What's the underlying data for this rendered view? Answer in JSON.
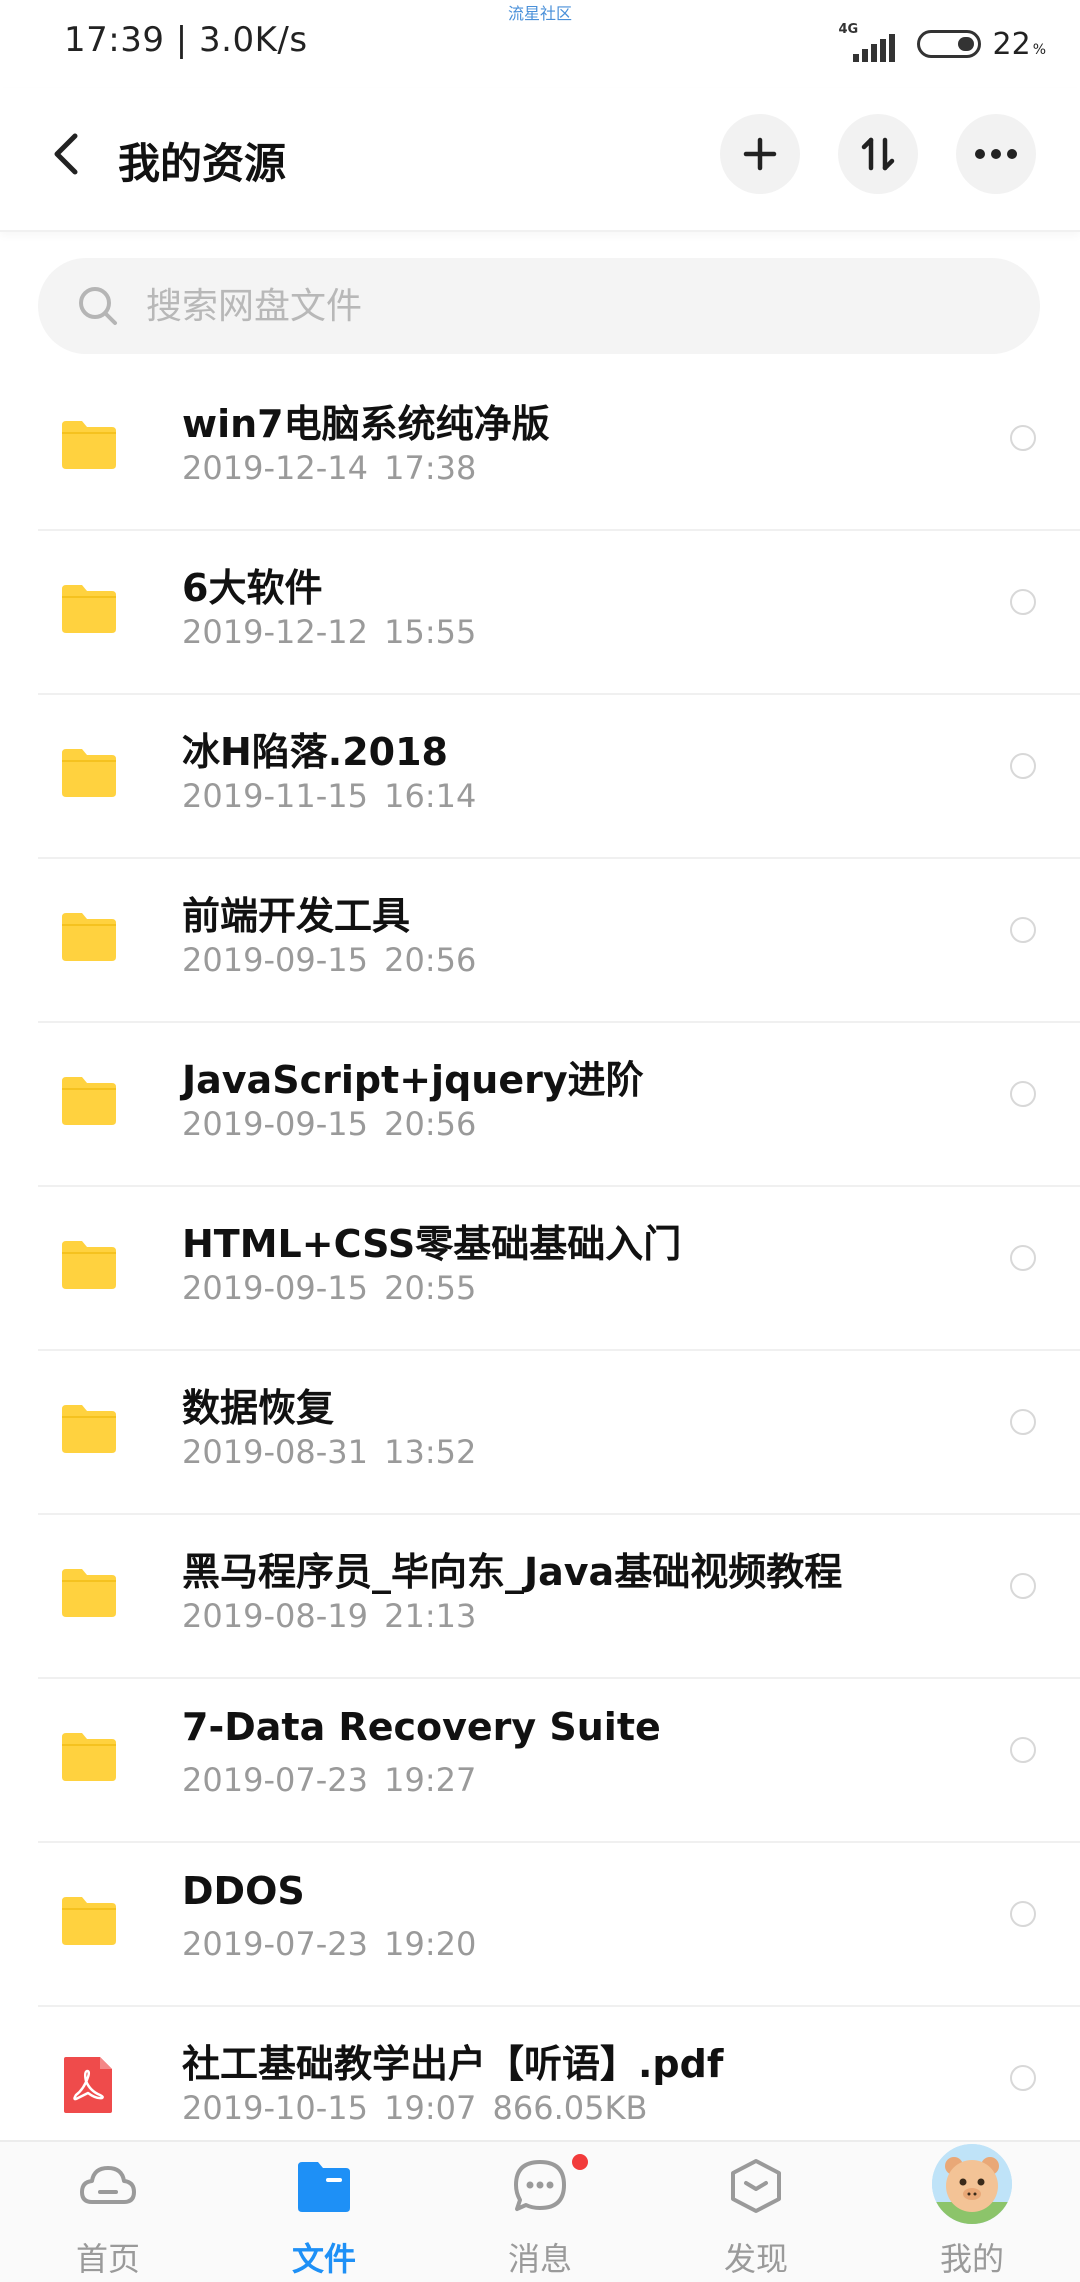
{
  "status_bar": {
    "time": "17:39 | 3.0K/s",
    "watermark": "流星社区",
    "network": "4G",
    "battery": "22",
    "battery_unit": "%"
  },
  "header": {
    "title": "我的资源"
  },
  "search": {
    "placeholder": "搜索网盘文件"
  },
  "files": [
    {
      "name": "win7电脑系统纯净版",
      "meta": "2019-12-14  17:38",
      "type": "folder-icon"
    },
    {
      "name": "6大软件",
      "meta": "2019-12-12  15:55",
      "type": "folder-icon"
    },
    {
      "name": "冰H陷落.2018",
      "meta": "2019-11-15  16:14",
      "type": "folder-icon"
    },
    {
      "name": "前端开发工具",
      "meta": "2019-09-15  20:56",
      "type": "folder-icon"
    },
    {
      "name": "JavaScript+jquery进阶",
      "meta": "2019-09-15  20:56",
      "type": "folder-icon"
    },
    {
      "name": "HTML+CSS零基础基础入门",
      "meta": "2019-09-15  20:55",
      "type": "folder-icon"
    },
    {
      "name": "数据恢复",
      "meta": "2019-08-31  13:52",
      "type": "folder-icon"
    },
    {
      "name": "黑马程序员_毕向东_Java基础视频教程",
      "meta": "2019-08-19  21:13",
      "type": "folder-icon"
    },
    {
      "name": "7-Data Recovery Suite",
      "meta": "2019-07-23  19:27",
      "type": "folder-icon"
    },
    {
      "name": "DDOS",
      "meta": "2019-07-23  19:20",
      "type": "folder-icon"
    },
    {
      "name": "社工基础教学出户【听语】.pdf",
      "meta": "2019-10-15  19:07  866.05KB",
      "type": "pdf-icon"
    }
  ],
  "nav": {
    "items": [
      {
        "label": "首页",
        "icon": "cloud-icon"
      },
      {
        "label": "文件",
        "icon": "folder-tab-icon"
      },
      {
        "label": "消息",
        "icon": "message-icon"
      },
      {
        "label": "发现",
        "icon": "discover-icon"
      },
      {
        "label": "我的",
        "icon": "avatar"
      }
    ],
    "active": "文件"
  },
  "colors": {
    "folder": "#FFD23F",
    "accent": "#1E90F6",
    "pdf": "#EF4B4B",
    "badge": "#F23B3B"
  }
}
